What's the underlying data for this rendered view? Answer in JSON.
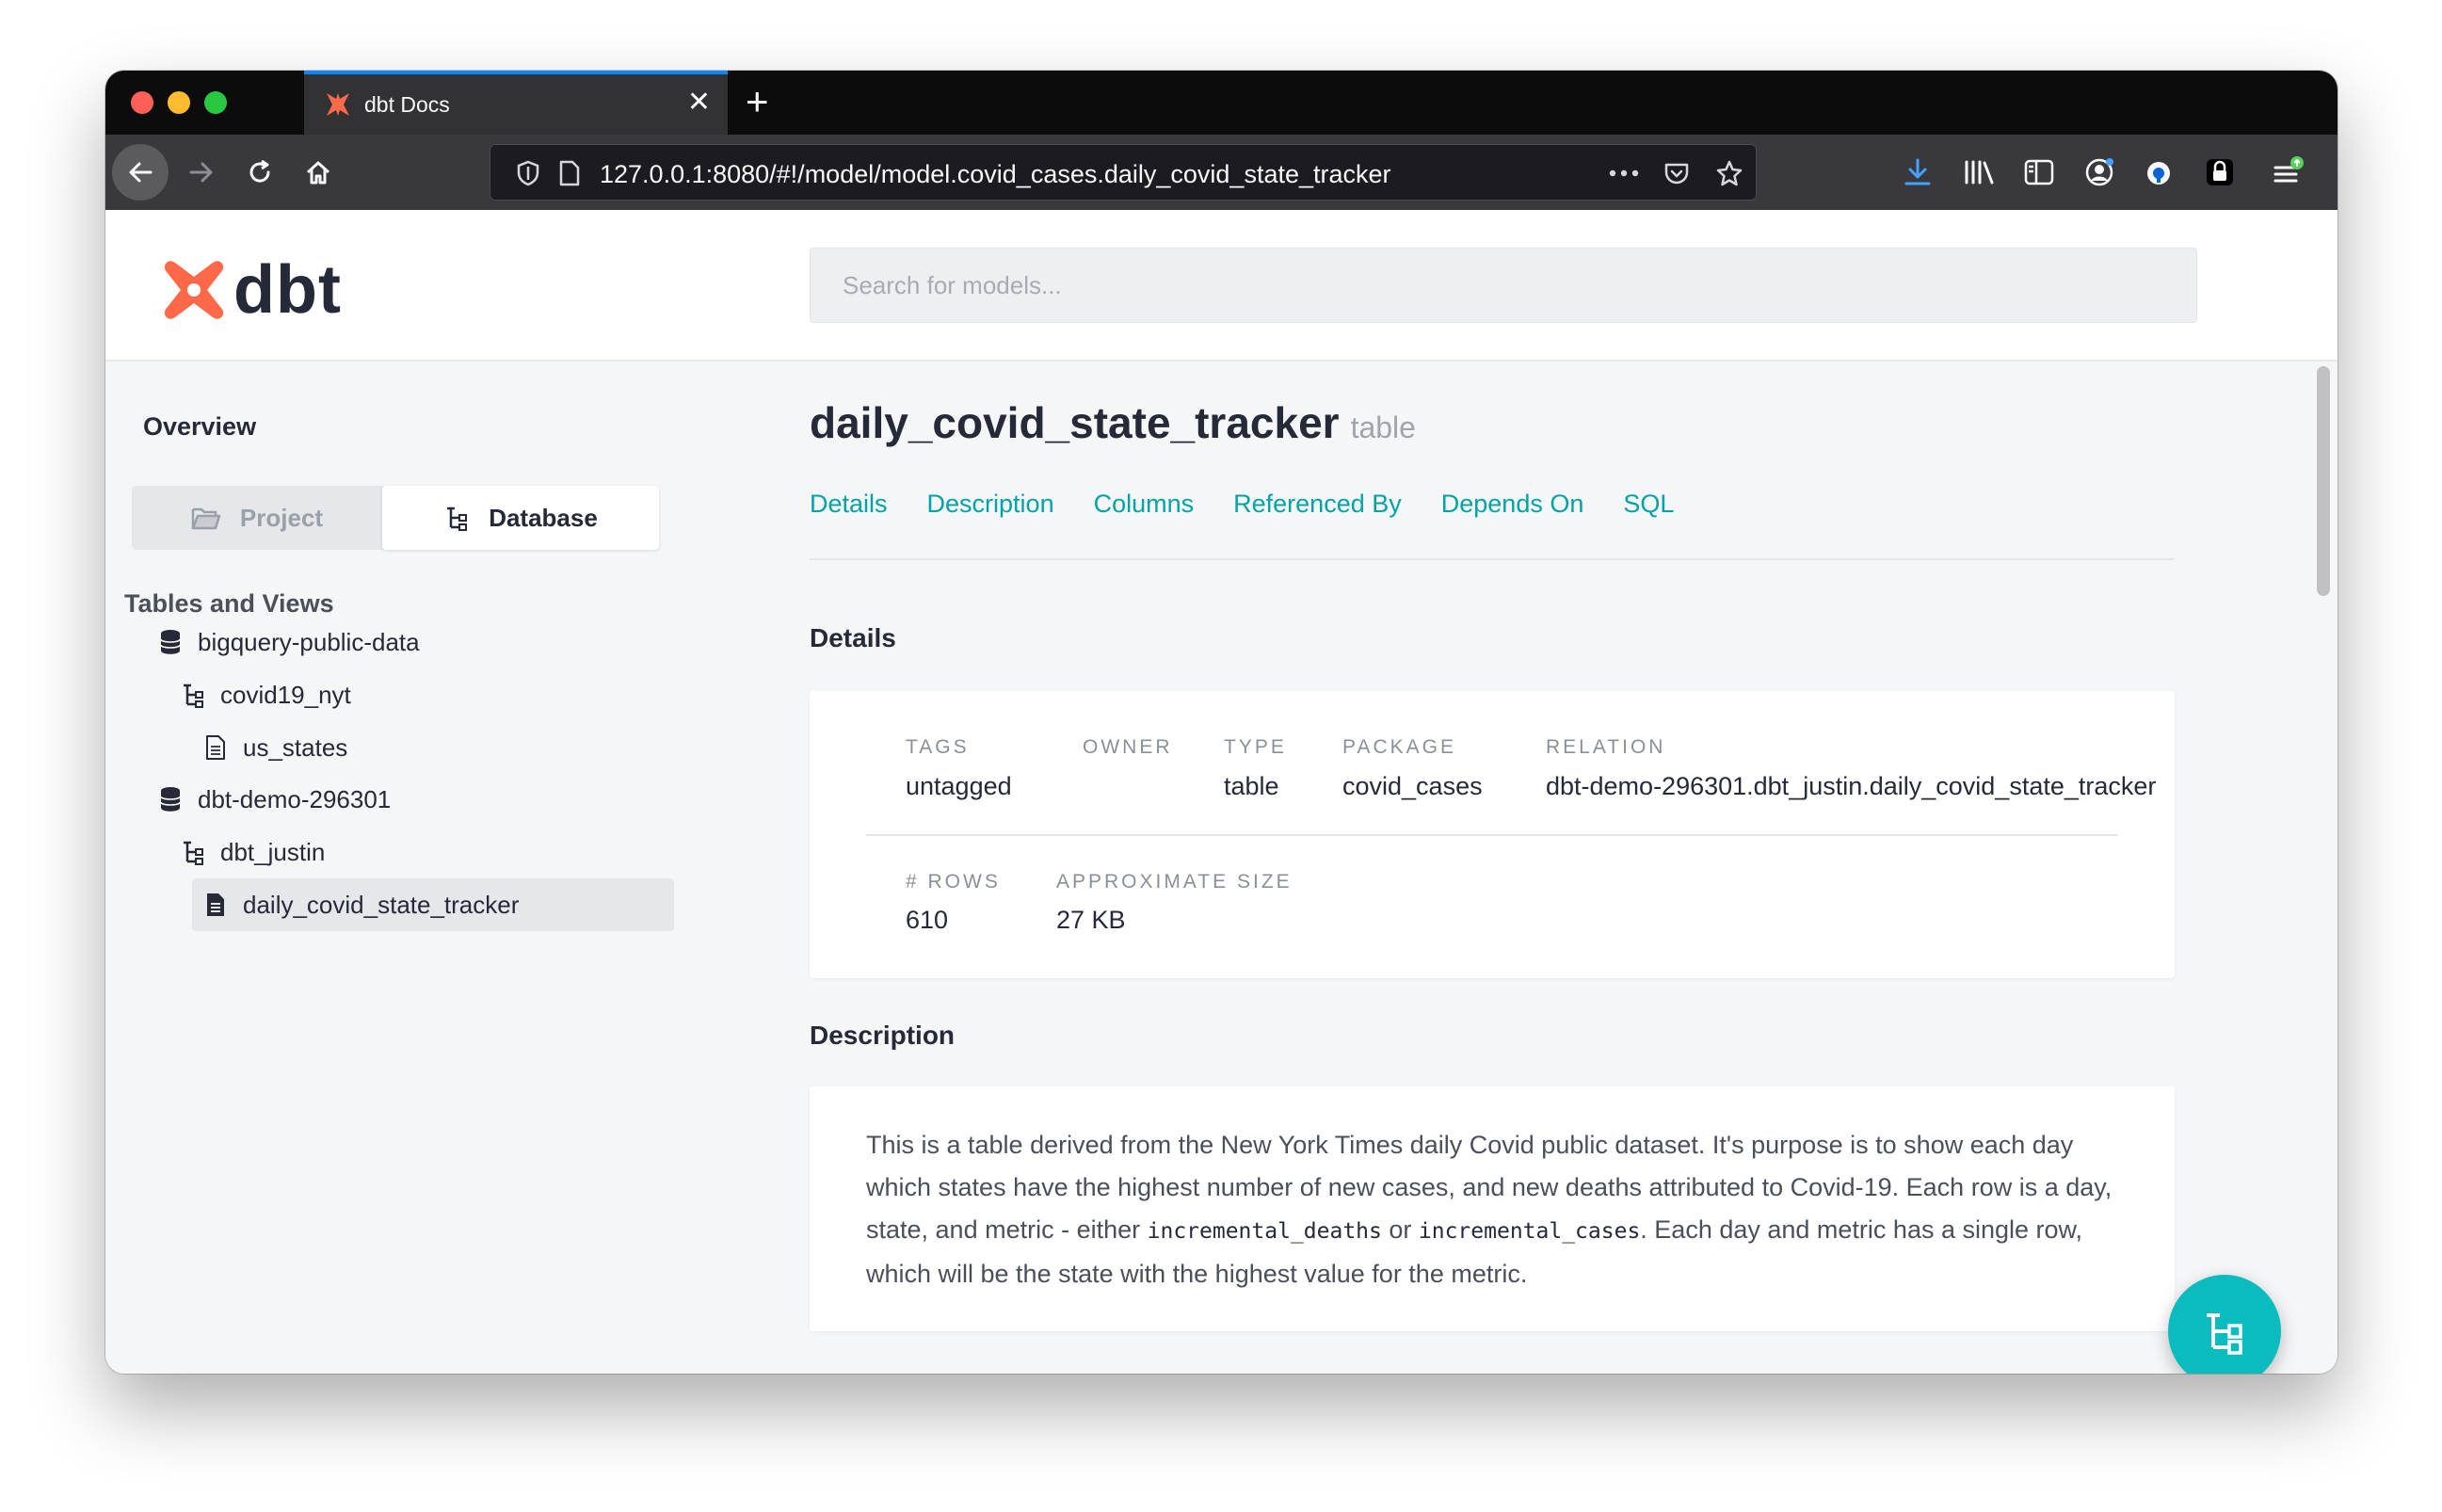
{
  "browser": {
    "tab_title": "dbt Docs",
    "tab_close": "✕",
    "new_tab": "+",
    "url": "127.0.0.1:8080/#!/model/model.covid_cases.daily_covid_state_tracker"
  },
  "header": {
    "logo_text": "dbt",
    "search_placeholder": "Search for models..."
  },
  "sidebar": {
    "overview": "Overview",
    "project_label": "Project",
    "database_label": "Database",
    "tables_header": "Tables and Views",
    "tree": [
      {
        "label": "bigquery-public-data",
        "icon": "database-icon"
      },
      {
        "label": "covid19_nyt",
        "icon": "schema-icon"
      },
      {
        "label": "us_states",
        "icon": "file-icon"
      },
      {
        "label": "dbt-demo-296301",
        "icon": "database-icon"
      },
      {
        "label": "dbt_justin",
        "icon": "schema-icon"
      },
      {
        "label": "daily_covid_state_tracker",
        "icon": "file-icon",
        "active": true
      }
    ]
  },
  "model": {
    "name": "daily_covid_state_tracker",
    "type": "table",
    "tabs": [
      "Details",
      "Description",
      "Columns",
      "Referenced By",
      "Depends On",
      "SQL"
    ],
    "details_title": "Details",
    "details": {
      "tags_label": "TAGS",
      "tags_value": "untagged",
      "owner_label": "OWNER",
      "owner_value": "",
      "type_label": "TYPE",
      "type_value": "table",
      "package_label": "PACKAGE",
      "package_value": "covid_cases",
      "relation_label": "RELATION",
      "relation_value": "dbt-demo-296301.dbt_justin.daily_covid_state_tracker",
      "rows_label": "# ROWS",
      "rows_value": "610",
      "size_label": "APPROXIMATE SIZE",
      "size_value": "27 KB"
    },
    "description_title": "Description",
    "description": {
      "part1": "This is a table derived from the New York Times daily Covid public dataset. It's purpose is to show each day which states have the highest number of new cases, and new deaths attributed to Covid-19. Each row is a day, state, and metric - either ",
      "code1": "incremental_deaths",
      "part2": " or ",
      "code2": "incremental_cases",
      "part3": ". Each day and metric has a single row, which will be the state with the highest value for the metric."
    }
  },
  "colors": {
    "accent": "#00a3a6",
    "fab": "#0bbcbf",
    "dbt_orange": "#ff694a",
    "text": "#262a38"
  }
}
